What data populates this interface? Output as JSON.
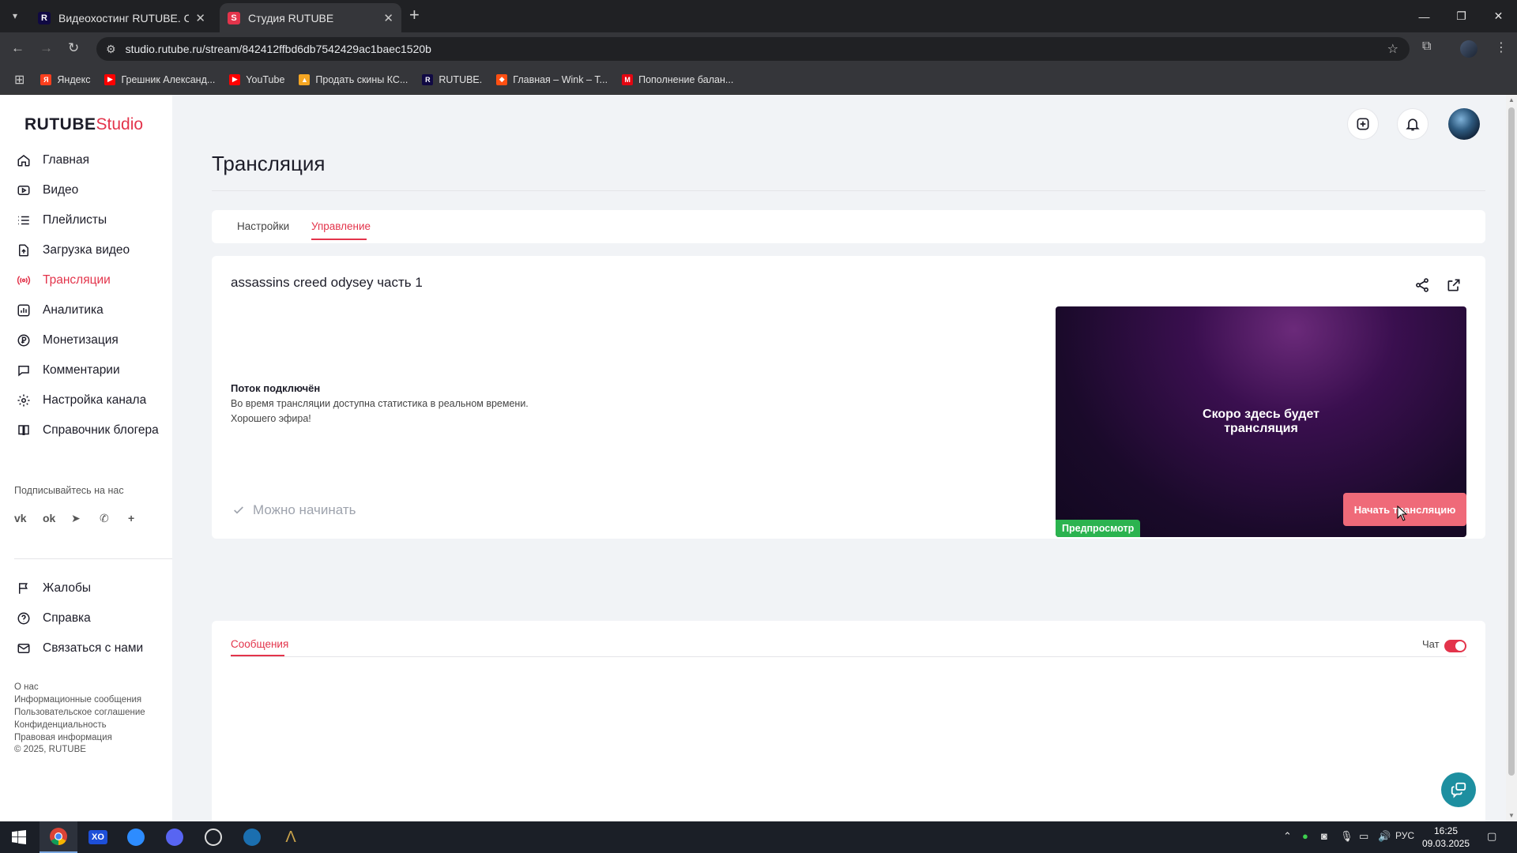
{
  "browser": {
    "tabs": [
      {
        "title": "Видеохостинг RUTUBE. Смотр",
        "favicon": "R",
        "active": false
      },
      {
        "title": "Студия RUTUBE",
        "favicon": "S",
        "active": true
      }
    ],
    "url": "studio.rutube.ru/stream/842412ffbd6db7542429ac1baec1520b",
    "bookmarks": [
      {
        "label": "Яндекс",
        "icon": "yandex-icon",
        "color": "#fc3f1d"
      },
      {
        "label": "Грешник Александ...",
        "icon": "youtube-icon",
        "color": "#ff0000"
      },
      {
        "label": "YouTube",
        "icon": "youtube-icon",
        "color": "#ff0000"
      },
      {
        "label": "Продать скины КС...",
        "icon": "market-icon",
        "color": "#f5a623"
      },
      {
        "label": "RUTUBE.",
        "icon": "rutube-icon",
        "color": "#100943"
      },
      {
        "label": "Главная – Wink – Т...",
        "icon": "wink-icon",
        "color": "#ff4f12"
      },
      {
        "label": "Пополнение балан...",
        "icon": "mts-icon",
        "color": "#e30611"
      }
    ]
  },
  "sidebar": {
    "logo": {
      "main": "RUTUBE",
      "sub": "Studio"
    },
    "items": [
      {
        "label": "Главная",
        "icon": "home-icon"
      },
      {
        "label": "Видео",
        "icon": "video-icon"
      },
      {
        "label": "Плейлисты",
        "icon": "playlist-icon"
      },
      {
        "label": "Загрузка видео",
        "icon": "upload-icon"
      },
      {
        "label": "Трансляции",
        "icon": "broadcast-icon",
        "active": true
      },
      {
        "label": "Аналитика",
        "icon": "analytics-icon"
      },
      {
        "label": "Монетизация",
        "icon": "ruble-icon"
      },
      {
        "label": "Комментарии",
        "icon": "comments-icon"
      },
      {
        "label": "Настройка канала",
        "icon": "settings-icon"
      },
      {
        "label": "Справочник блогера",
        "icon": "book-icon"
      }
    ],
    "follow_label": "Подписывайтесь на нас",
    "socials": [
      "vk-icon",
      "ok-icon",
      "telegram-icon",
      "viber-icon",
      "more-icon"
    ],
    "items2": [
      {
        "label": "Жалобы",
        "icon": "flag-icon"
      },
      {
        "label": "Справка",
        "icon": "help-icon"
      },
      {
        "label": "Связаться с нами",
        "icon": "mail-icon"
      }
    ],
    "footer_links": [
      "О нас",
      "Информационные сообщения",
      "Пользовательское соглашение",
      "Конфиденциальность",
      "Правовая информация"
    ],
    "copyright": "© 2025, RUTUBE"
  },
  "page": {
    "title": "Трансляция",
    "tabs": [
      {
        "label": "Настройки",
        "active": false
      },
      {
        "label": "Управление",
        "active": true
      }
    ],
    "stream": {
      "title": "assassins creed odysey часть 1",
      "status_title": "Поток подключён",
      "status_lines": [
        "Во время трансляции доступна статистика в реальном времени.",
        "Хорошего эфира!"
      ],
      "preview_text_line1": "Скоро здесь будет",
      "preview_text_line2": "трансляция",
      "preview_badge": "Предпросмотр",
      "ready_label": "Можно начинать",
      "start_button": "Начать трансляцию"
    },
    "chat": {
      "tab_label": "Сообщения",
      "toggle_label": "Чат",
      "toggle_on": true
    }
  },
  "taskbar": {
    "language": "РУС",
    "time": "16:25",
    "date": "09.03.2025"
  },
  "colors": {
    "accent": "#e3344b",
    "button": "#ef6a79",
    "preview_badge": "#2bb34f",
    "help_fab": "#1d8fa0"
  }
}
